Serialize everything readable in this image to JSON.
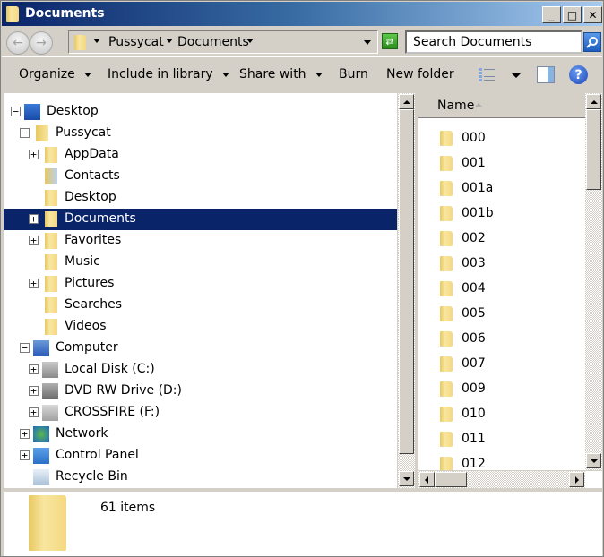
{
  "window": {
    "title": "Documents",
    "controls": {
      "minimize": "_",
      "maximize": "□",
      "close": "✕"
    }
  },
  "address": {
    "breadcrumbs": [
      "Pussycat",
      "Documents"
    ],
    "search_placeholder": "Search Documents"
  },
  "commandbar": {
    "organize": "Organize",
    "include_in_library": "Include in library",
    "share_with": "Share with",
    "burn": "Burn",
    "new_folder": "New folder"
  },
  "tree": [
    {
      "label": "Desktop",
      "icon": "desktop-icon",
      "level": 0,
      "expander": "minus"
    },
    {
      "label": "Pussycat",
      "icon": "user-folder-icon",
      "level": 1,
      "expander": "minus"
    },
    {
      "label": "AppData",
      "icon": "folder-icon",
      "level": 2,
      "expander": "plus"
    },
    {
      "label": "Contacts",
      "icon": "contacts-folder-icon",
      "level": 2,
      "expander": "none"
    },
    {
      "label": "Desktop",
      "icon": "folder-icon",
      "level": 2,
      "expander": "none"
    },
    {
      "label": "Documents",
      "icon": "folder-icon",
      "level": 2,
      "expander": "plus",
      "selected": true
    },
    {
      "label": "Favorites",
      "icon": "folder-icon",
      "level": 2,
      "expander": "plus"
    },
    {
      "label": "Music",
      "icon": "folder-icon",
      "level": 2,
      "expander": "none"
    },
    {
      "label": "Pictures",
      "icon": "folder-icon",
      "level": 2,
      "expander": "plus"
    },
    {
      "label": "Searches",
      "icon": "folder-icon",
      "level": 2,
      "expander": "none"
    },
    {
      "label": "Videos",
      "icon": "folder-icon",
      "level": 2,
      "expander": "none"
    },
    {
      "label": "Computer",
      "icon": "computer-icon",
      "level": 1,
      "expander": "minus"
    },
    {
      "label": "Local Disk (C:)",
      "icon": "local-disk-icon",
      "level": 2,
      "expander": "plus"
    },
    {
      "label": "DVD RW Drive (D:)",
      "icon": "dvd-drive-icon",
      "level": 2,
      "expander": "plus"
    },
    {
      "label": "CROSSFIRE (F:)",
      "icon": "removable-drive-icon",
      "level": 2,
      "expander": "plus"
    },
    {
      "label": "Network",
      "icon": "network-icon",
      "level": 1,
      "expander": "plus"
    },
    {
      "label": "Control Panel",
      "icon": "control-panel-icon",
      "level": 1,
      "expander": "plus"
    },
    {
      "label": "Recycle Bin",
      "icon": "recycle-bin-icon",
      "level": 1,
      "expander": "none"
    }
  ],
  "list": {
    "column_name": "Name",
    "items": [
      "000",
      "001",
      "001a",
      "001b",
      "002",
      "003",
      "004",
      "005",
      "006",
      "007",
      "009",
      "010",
      "011",
      "012"
    ]
  },
  "details": {
    "count": "61 items"
  },
  "colors": {
    "selection": "#0a246a",
    "titlebar_start": "#0a246a",
    "titlebar_end": "#a6caf0",
    "chrome": "#d4d0c8"
  }
}
